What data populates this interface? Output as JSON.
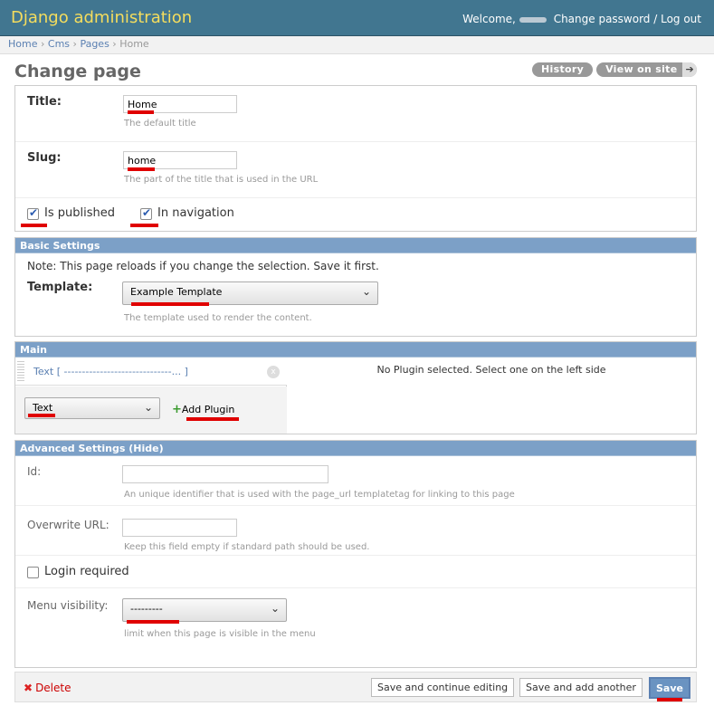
{
  "header": {
    "brand": "Django administration",
    "welcome": "Welcome,",
    "change_password": "Change password",
    "separator": " / ",
    "log_out": "Log out"
  },
  "breadcrumbs": {
    "items": [
      "Home",
      "Cms",
      "Pages",
      "Home"
    ],
    "separator": " › "
  },
  "page": {
    "title": "Change page",
    "history": "History",
    "view_on_site": "View on site",
    "view_arrow": "➔"
  },
  "main_form": {
    "title_label": "Title:",
    "title_value": "Home",
    "title_help": "The default title",
    "slug_label": "Slug:",
    "slug_value": "home",
    "slug_help": "The part of the title that is used in the URL",
    "is_published": "Is published",
    "in_navigation": "In navigation"
  },
  "basic_settings": {
    "heading": "Basic Settings",
    "note": "Note: This page reloads if you change the selection. Save it first.",
    "template_label": "Template:",
    "template_value": "Example Template",
    "template_help": "The template used to render the content."
  },
  "main_placeholder": {
    "heading": "Main",
    "plugin_tab": "Text [ ------------------------------... ]",
    "close": "x",
    "plugin_select": "Text",
    "add_plugin": "Add Plugin",
    "no_plugin": "No Plugin selected. Select one on the left side"
  },
  "advanced": {
    "heading_prefix": "Advanced Settings (",
    "hide": "Hide",
    "heading_suffix": ")",
    "id_label": "Id:",
    "id_value": "",
    "id_help": "An unique identifier that is used with the page_url templatetag for linking to this page",
    "overwrite_label": "Overwrite URL:",
    "overwrite_value": "",
    "overwrite_help": "Keep this field empty if standard path should be used.",
    "login_required": "Login required",
    "menu_label": "Menu visibility:",
    "menu_value": "---------",
    "menu_help": "limit when this page is visible in the menu"
  },
  "submit": {
    "delete": "Delete",
    "save_continue": "Save and continue editing",
    "save_add": "Save and add another",
    "save": "Save"
  },
  "colors": {
    "header_bg": "#417690",
    "brand": "#f5dd5d",
    "module_header": "#7ca0c7",
    "annotation": "#e00000"
  }
}
